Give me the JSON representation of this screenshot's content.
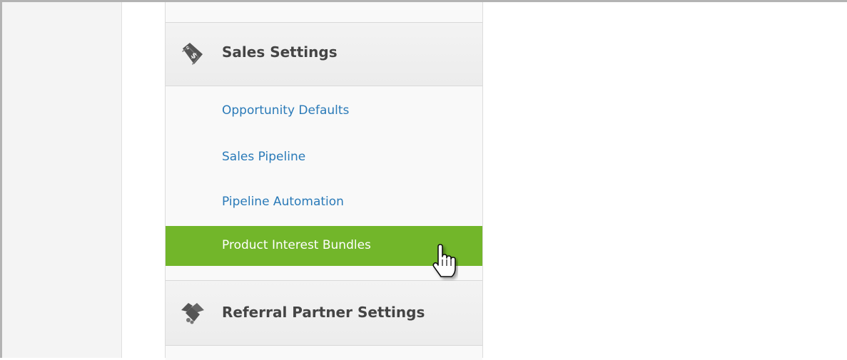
{
  "sidebar": {
    "sections": [
      {
        "title": "Sales Settings",
        "icon": "price-tag-icon",
        "items": [
          {
            "label": "Opportunity Defaults",
            "active": false
          },
          {
            "label": "Sales Pipeline",
            "active": false
          },
          {
            "label": "Pipeline Automation",
            "active": false
          },
          {
            "label": "Product Interest Bundles",
            "active": true
          }
        ]
      },
      {
        "title": "Referral Partner Settings",
        "icon": "handshake-icon",
        "items": []
      }
    ]
  },
  "colors": {
    "active_item": "#72b62a",
    "link_text": "#2a7ab8",
    "header_text": "#444444"
  }
}
